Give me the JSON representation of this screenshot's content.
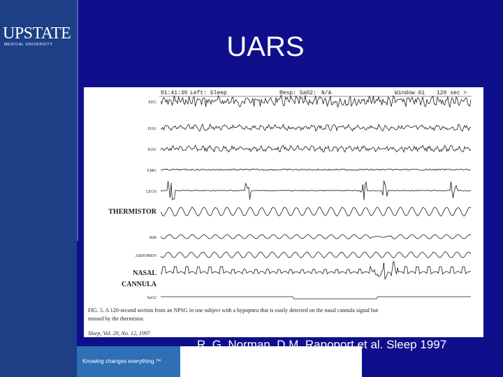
{
  "brand": {
    "name": "UPSTATE",
    "subtitle": "MEDICAL UNIVERSITY",
    "tagline": "Knowing changes everything.™"
  },
  "slide": {
    "title": "UARS",
    "citation": "R. G. Norman, D.M. Rapoport et al. Sleep 1997"
  },
  "figure": {
    "header_fields": [
      "01:41:30",
      "Left: Sleep",
      "Resp: SaO2:",
      "N/A",
      "Window 61",
      "120 sec >"
    ],
    "channels": [
      {
        "label": "EEG",
        "kind": "eeg"
      },
      {
        "label": "EOG",
        "kind": "eog"
      },
      {
        "label": "EOG",
        "kind": "eog"
      },
      {
        "label": "EMG",
        "kind": "emg"
      },
      {
        "label": "LEGS",
        "kind": "legs"
      },
      {
        "label": "THERMISTOR",
        "kind": "thermistor"
      },
      {
        "label": "RIB",
        "kind": "rib"
      },
      {
        "label": "ABDOMEN",
        "kind": "abdomen"
      },
      {
        "label": "NASAL",
        "kind": "nasal"
      },
      {
        "label": "CANNULA",
        "kind": "label_only"
      },
      {
        "label": "SaO2",
        "kind": "sao2"
      }
    ],
    "caption_lines": [
      "FIG. 5.  A 120-second section from an NPSG in one subject with a hypopnea that is easily detected on the nasal cannula signal but",
      "missed by the thermistor."
    ],
    "journal_ref": "Sleep, Vol. 20, No. 12, 1997"
  },
  "colors": {
    "background": "#0f0f8c",
    "sidebar": "#1c3f86",
    "tagline_accent": "#2e6fb5",
    "trace": "#1a1a1a"
  }
}
